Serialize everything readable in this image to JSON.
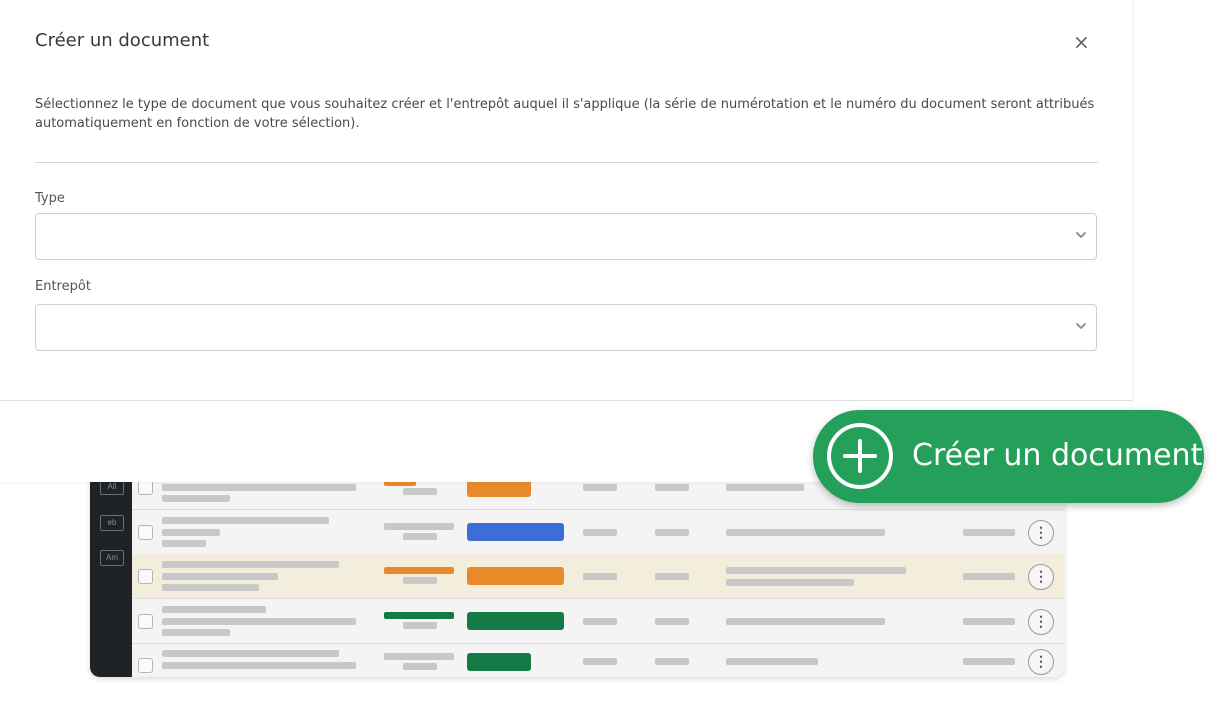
{
  "modal": {
    "title": "Créer un document",
    "close_label": "×",
    "description": "Sélectionnez le type de document que vous souhaitez créer et l'entrepôt auquel il s'applique (la série de numérotation et le numéro du document seront attribués automatiquement en fonction de votre sélection).",
    "fields": [
      {
        "label": "Type",
        "value": ""
      },
      {
        "label": "Entrepôt",
        "value": ""
      }
    ]
  },
  "cta": {
    "label": "Créer un document",
    "icon": "plus-circle-icon",
    "color": "#24a05a"
  },
  "background": {
    "sidebar_tags": [
      "All",
      "eb",
      "Am"
    ],
    "status_colors": [
      "#e88a2a",
      "#3b6fd4",
      "#e88a2a",
      "#137a45",
      "#137a45"
    ]
  }
}
